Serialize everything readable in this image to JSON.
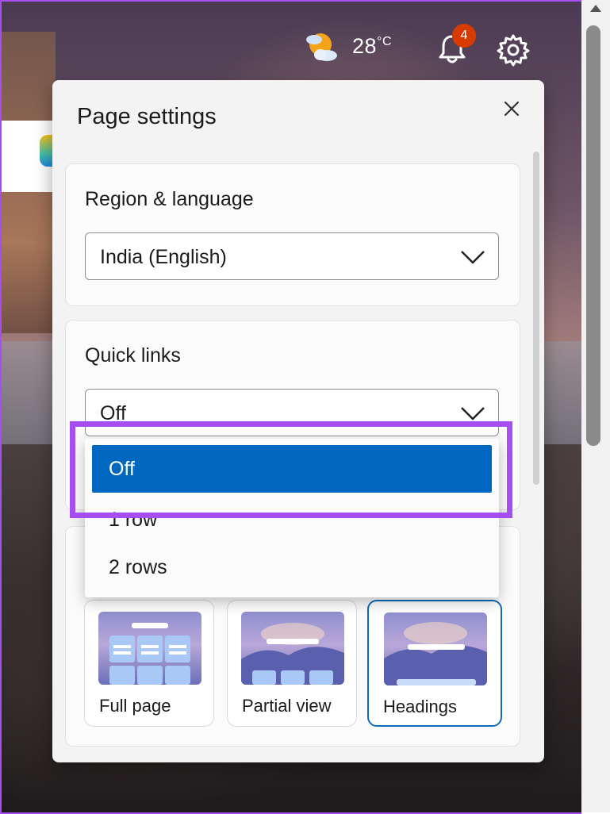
{
  "topbar": {
    "weather_icon": "sun-behind-cloud-icon",
    "temperature": "28",
    "temperature_unit": "°C",
    "notifications_count": "4",
    "bell_icon": "bell-icon",
    "settings_icon": "gear-icon"
  },
  "dialog": {
    "title": "Page settings",
    "close_icon": "close-icon",
    "region": {
      "title": "Region & language",
      "selected": "India (English)"
    },
    "quick_links": {
      "title": "Quick links",
      "selected": "Off",
      "options": [
        "Off",
        "1 row",
        "2 rows"
      ]
    },
    "layouts": [
      {
        "label": "Full page",
        "active": false
      },
      {
        "label": "Partial view",
        "active": false
      },
      {
        "label": "Headings",
        "active": true
      }
    ]
  },
  "colors": {
    "accent": "#0067c0",
    "highlight": "#a64ff0",
    "badge": "#d83b01"
  }
}
